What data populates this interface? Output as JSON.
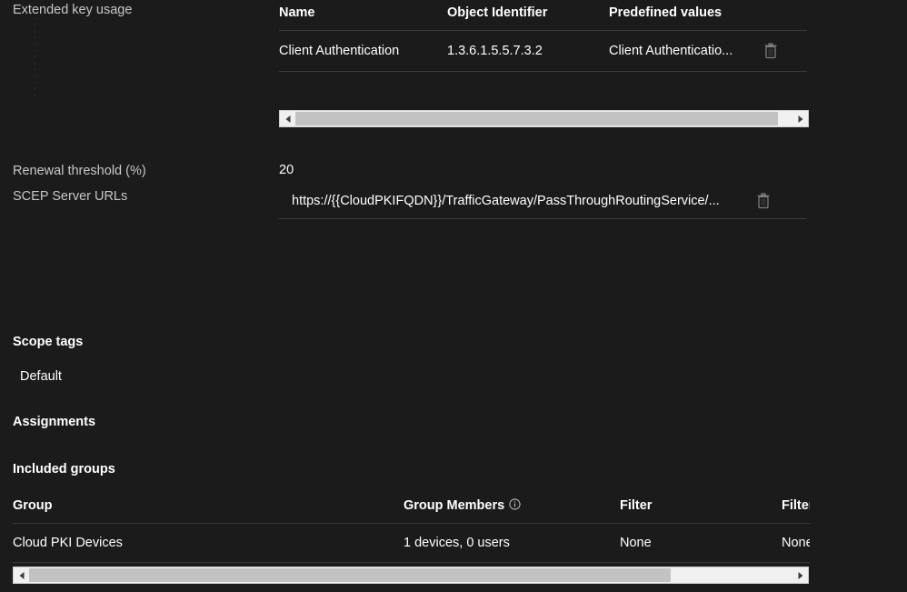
{
  "fields": {
    "extended_key_usage_label": "Extended key usage",
    "renewal_threshold_label": "Renewal threshold (%)",
    "renewal_threshold_value": "20",
    "scep_server_urls_label": "SCEP Server URLs",
    "scep_server_url_value": "https://{{CloudPKIFQDN}}/TrafficGateway/PassThroughRoutingService/..."
  },
  "eku_table": {
    "columns": [
      "Name",
      "Object Identifier",
      "Predefined values"
    ],
    "rows": [
      {
        "name": "Client Authentication",
        "object_identifier": "1.3.6.1.5.5.7.3.2",
        "predefined_values": "Client Authenticatio...",
        "delete_icon": "trash-icon"
      }
    ]
  },
  "eku_scrollbar": {
    "left_arrow": "scroll-left-arrow",
    "right_arrow": "scroll-right-arrow",
    "thumb_percent": 97
  },
  "scope_tags": {
    "heading": "Scope tags",
    "items": [
      "Default"
    ]
  },
  "assignments": {
    "heading": "Assignments",
    "included_groups_heading": "Included groups",
    "columns": [
      "Group",
      "Group Members",
      "Filter",
      "Filter"
    ],
    "group_members_info_icon": "info-icon",
    "rows": [
      {
        "group": "Cloud PKI Devices",
        "group_members": "1 devices, 0 users",
        "filter_mode": "None",
        "filter_name": "None"
      }
    ]
  },
  "assignments_scrollbar": {
    "left_arrow": "scroll-left-arrow",
    "right_arrow": "scroll-right-arrow",
    "thumb_percent": 84
  },
  "colors": {
    "background": "#1b1b1b",
    "label": "#c7c7c7",
    "value": "#ffffff",
    "divider": "#3b3b3b",
    "scrollbar_track": "#f0f0f0",
    "scrollbar_thumb": "#c2c2c2"
  }
}
